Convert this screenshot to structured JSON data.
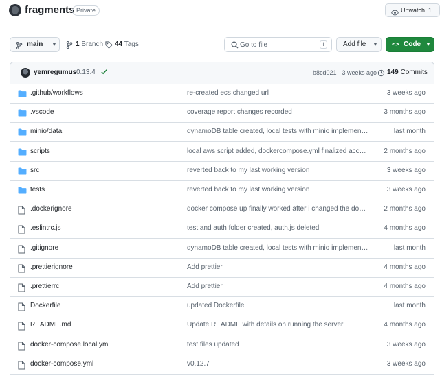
{
  "repo": {
    "name": "fragments",
    "visibility": "Private",
    "unwatch_label": "Unwatch",
    "watch_count": "1"
  },
  "toolbar": {
    "branch": "main",
    "branches_count": "1",
    "branches_label": "Branch",
    "tags_count": "44",
    "tags_label": "Tags",
    "goto_placeholder": "Go to file",
    "goto_shortcut": "t",
    "add_file_label": "Add file",
    "code_label": "Code"
  },
  "commit": {
    "author": "yemregumus",
    "message": "0.13.4",
    "hash_time": "b8cd021 · 3 weeks ago",
    "commits_count": "149",
    "commits_label": "Commits"
  },
  "colors": {
    "folder": "#54aeff",
    "accent_green": "#1f883d",
    "check_green": "#1a7f37"
  },
  "files": [
    {
      "name": ".github/workflows",
      "type": "folder",
      "message": "re-created ecs changed url",
      "date": "3 weeks ago"
    },
    {
      "name": ".vscode",
      "type": "folder",
      "message": "coverage report changes recorded",
      "date": "3 months ago"
    },
    {
      "name": "minio/data",
      "type": "folder",
      "message": "dynamoDB table created, local tests with minio implemente...",
      "date": "last month"
    },
    {
      "name": "scripts",
      "type": "folder",
      "message": "local aws script added, dockercompose.yml finalized accordi...",
      "date": "2 months ago"
    },
    {
      "name": "src",
      "type": "folder",
      "message": "reverted back to my last working version",
      "date": "3 weeks ago"
    },
    {
      "name": "tests",
      "type": "folder",
      "message": "reverted back to my last working version",
      "date": "3 weeks ago"
    },
    {
      "name": ".dockerignore",
      "type": "file",
      "message": "docker compose up finally worked after i changed the docke...",
      "date": "2 months ago"
    },
    {
      "name": ".eslintrc.js",
      "type": "file",
      "message": "test and auth folder created, auth.js deleted",
      "date": "4 months ago"
    },
    {
      "name": ".gitignore",
      "type": "file",
      "message": "dynamoDB table created, local tests with minio implemente...",
      "date": "last month"
    },
    {
      "name": ".prettierignore",
      "type": "file",
      "message": "Add prettier",
      "date": "4 months ago"
    },
    {
      "name": ".prettierrc",
      "type": "file",
      "message": "Add prettier",
      "date": "4 months ago"
    },
    {
      "name": "Dockerfile",
      "type": "file",
      "message": "updated Dockerfile",
      "date": "last month"
    },
    {
      "name": "README.md",
      "type": "file",
      "message": "Update README with details on running the server",
      "date": "4 months ago"
    },
    {
      "name": "docker-compose.local.yml",
      "type": "file",
      "message": "test files updated",
      "date": "3 weeks ago"
    },
    {
      "name": "docker-compose.yml",
      "type": "file",
      "message": "v0.12.7",
      "date": "3 weeks ago"
    }
  ]
}
